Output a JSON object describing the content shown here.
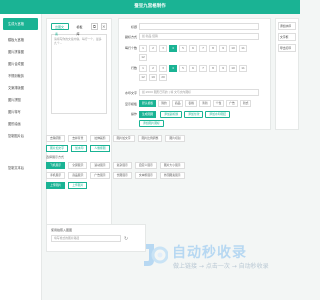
{
  "header": {
    "title": "蚕豆九宫格制作"
  },
  "sidebar": {
    "items": [
      {
        "label": "生成九宫格"
      },
      {
        "label": "模板九宫格"
      },
      {
        "label": "图片拼接图"
      },
      {
        "label": "图片合成图"
      },
      {
        "label": "不规则裁剪"
      },
      {
        "label": "文案排版图"
      },
      {
        "label": "图片拼图"
      },
      {
        "label": "图片特写"
      },
      {
        "label": "图形绘画"
      },
      {
        "label": "复制图片后"
      }
    ],
    "bottom_item": "复制文本后"
  },
  "mid": {
    "tab1": "出图文案",
    "tab2": "模板库",
    "text": "请填写你的文案内容，每行一个，最多九个..."
  },
  "right": {
    "title_label": "标题",
    "subtitle_label": "副标方式",
    "subtitle_placeholder": "如:新品 促销",
    "cols_label": "每行个数",
    "nums_row": [
      "1",
      "2",
      "3",
      "4",
      "5",
      "6",
      "7",
      "8",
      "9",
      "10",
      "11",
      "12"
    ],
    "nums_row2": [
      "13",
      "14",
      "15",
      "16",
      "17",
      "18",
      "19",
      "20"
    ],
    "rows_label": "行数",
    "rows_nums": [
      "1",
      "2",
      "3",
      "4",
      "5",
      "6",
      "7",
      "8",
      "9",
      "10",
      "11",
      "12"
    ],
    "rows_nums2": [
      "19",
      "20"
    ],
    "wm_label": "水印文字",
    "wm_placeholder": "如:2000 图形已有的 | 填 文与文内图标",
    "mode_label": "显示模板",
    "modes": [
      "默认模板",
      "简约",
      "商品",
      "表格",
      "清新",
      "个性",
      "广告",
      "新式"
    ],
    "op_label": "操作",
    "ops": [
      "生成图图",
      "添加副标题",
      "添加付款",
      "添加水印图层",
      "添加图片图标"
    ]
  },
  "far": {
    "btns": [
      "添加水印",
      "文字框",
      "导出打印"
    ]
  },
  "bottom": {
    "row1": [
      "去除阴影",
      "去掉背景",
      "拉伸裁剪",
      "图片加文字",
      "图片比例调整",
      "图片切割"
    ],
    "row2": [
      "图片加文字",
      "加水印",
      "人像抠图"
    ],
    "label2": "选择展示方式",
    "row3": [
      "飞机展示",
      "全屏展示",
      "滚动展示",
      "复杂展示",
      "自定义展示",
      "图片大小展示"
    ],
    "row4": [
      "手机展示",
      "商品展示",
      "广告展示",
      "长图展示",
      "文本框展示",
      "外围图案展示"
    ],
    "row5": [
      "上传图片",
      "上传图片"
    ],
    "bottom_label": "使用拍照入图图",
    "bottom_input": "填写格式的图片路径"
  },
  "watermark": {
    "title": "自动秒收录",
    "subtitle": "做上链接 → 点击一次 → 自动秒收录"
  },
  "colors": {
    "accent": "#1ab394"
  }
}
